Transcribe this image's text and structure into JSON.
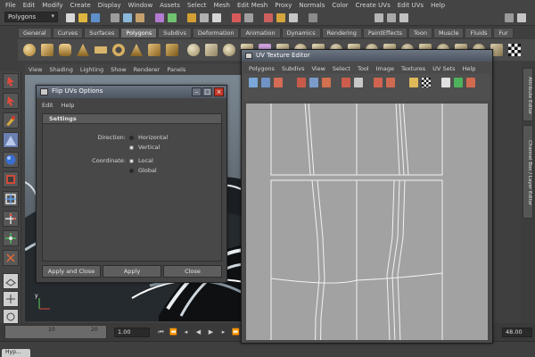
{
  "main_menu": [
    "File",
    "Edit",
    "Modify",
    "Create",
    "Display",
    "Window",
    "Assets",
    "Select",
    "Mesh",
    "Edit Mesh",
    "Proxy",
    "Normals",
    "Color",
    "Create UVs",
    "Edit UVs",
    "Help"
  ],
  "status_line": {
    "mode": "Polygons"
  },
  "shelf_tabs": [
    {
      "label": "General",
      "active": false
    },
    {
      "label": "Curves",
      "active": false
    },
    {
      "label": "Surfaces",
      "active": false
    },
    {
      "label": "Polygons",
      "active": true
    },
    {
      "label": "Subdivs",
      "active": false
    },
    {
      "label": "Deformation",
      "active": false
    },
    {
      "label": "Animation",
      "active": false
    },
    {
      "label": "Dynamics",
      "active": false
    },
    {
      "label": "Rendering",
      "active": false
    },
    {
      "label": "PaintEffects",
      "active": false
    },
    {
      "label": "Toon",
      "active": false
    },
    {
      "label": "Muscle",
      "active": false
    },
    {
      "label": "Fluids",
      "active": false
    },
    {
      "label": "Fur",
      "active": false
    }
  ],
  "viewport_menu": [
    "View",
    "Shading",
    "Lighting",
    "Show",
    "Renderer",
    "Panels"
  ],
  "axis_label": "y",
  "side_tabs": [
    "Attribute Editor",
    "Channel Box / Layer Editor"
  ],
  "time_slider": {
    "tick_labels": [
      "10",
      "20"
    ],
    "current_frame": "1.00",
    "end_frame": "48.00"
  },
  "bottom_tab": "Hyp...",
  "flip_dialog": {
    "title": "Flip UVs Options",
    "menu": [
      "Edit",
      "Help"
    ],
    "section_title": "Settings",
    "direction": {
      "label": "Direction:",
      "options": [
        "Horizontal",
        "Vertical"
      ],
      "selected": "Vertical"
    },
    "coordinate": {
      "label": "Coordinate:",
      "options": [
        "Local",
        "Global"
      ],
      "selected": "Local"
    },
    "buttons": {
      "apply_close": "Apply and Close",
      "apply": "Apply",
      "close": "Close"
    }
  },
  "uv_editor": {
    "title": "UV Texture Editor",
    "menu": [
      "Polygons",
      "Subdivs",
      "View",
      "Select",
      "Tool",
      "Image",
      "Textures",
      "UV Sets",
      "Help"
    ]
  }
}
